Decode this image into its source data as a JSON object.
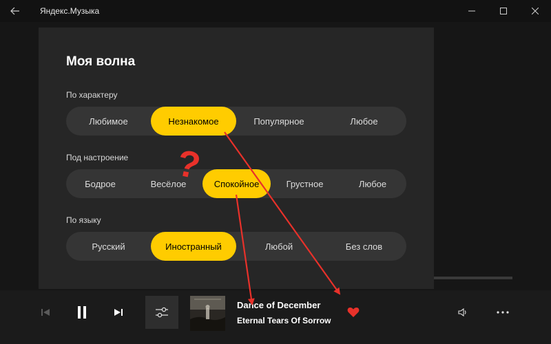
{
  "app": {
    "title": "Яндекс.Музыка"
  },
  "dialog": {
    "title": "Моя волна",
    "sections": [
      {
        "label": "По характеру",
        "options": [
          "Любимое",
          "Незнакомое",
          "Популярное",
          "Любое"
        ],
        "selected": "Незнакомое"
      },
      {
        "label": "Под настроение",
        "options": [
          "Бодрое",
          "Весёлое",
          "Спокойное",
          "Грустное",
          "Любое"
        ],
        "selected": "Спокойное"
      },
      {
        "label": "По языку",
        "options": [
          "Русский",
          "Иностранный",
          "Любой",
          "Без слов"
        ],
        "selected": "Иностранный"
      }
    ]
  },
  "player": {
    "track_title": "Dance of December",
    "track_artist": "Eternal Tears Of Sorrow",
    "state": "playing",
    "liked": true
  },
  "annotation": {
    "mark": "?"
  },
  "colors": {
    "accent": "#ffcc00",
    "annotation": "#e8312a",
    "dialog_bg": "#262626",
    "segment_bg": "#353535"
  }
}
